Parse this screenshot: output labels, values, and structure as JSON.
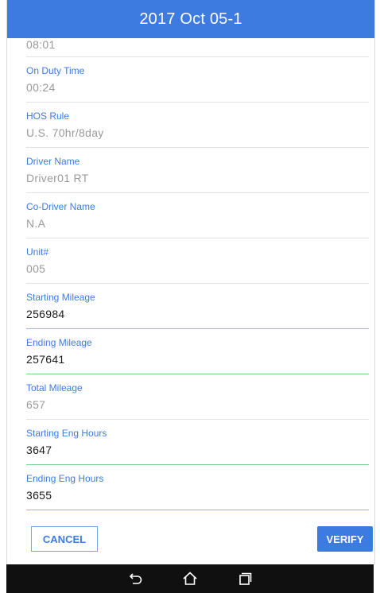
{
  "header": {
    "title": "2017 Oct 05-1"
  },
  "top_value": "08:01",
  "fields": [
    {
      "label": "On Duty Time",
      "value": "00:24"
    },
    {
      "label": "HOS Rule",
      "value": "U.S. 70hr/8day"
    },
    {
      "label": "Driver Name",
      "value": "Driver01 RT"
    },
    {
      "label": "Co-Driver Name",
      "value": "N.A"
    },
    {
      "label": "Unit#",
      "value": "005"
    },
    {
      "label": "Starting Mileage",
      "value": "256984"
    },
    {
      "label": "Ending Mileage",
      "value": "257641"
    },
    {
      "label": "Total Mileage",
      "value": "657"
    },
    {
      "label": "Starting Eng Hours",
      "value": "3647"
    },
    {
      "label": "Ending Eng Hours",
      "value": "3655"
    }
  ],
  "buttons": {
    "cancel": "CANCEL",
    "verify": "VERIFY"
  },
  "colors": {
    "accent": "#3d7be0",
    "editable_underline": "#7fd68c",
    "navbar": "#101010"
  },
  "navbar_icons": [
    "back-icon",
    "home-icon",
    "recents-icon"
  ]
}
